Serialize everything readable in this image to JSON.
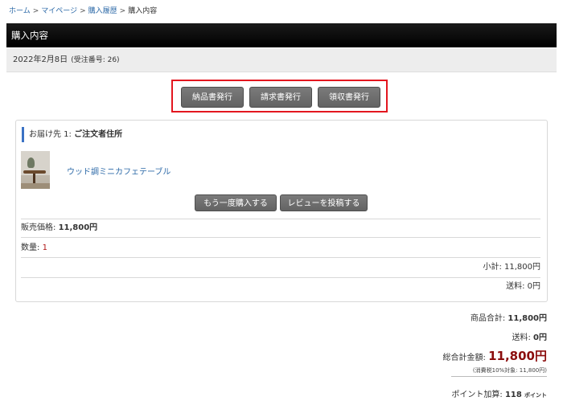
{
  "breadcrumb": {
    "home": "ホーム",
    "mypage": "マイページ",
    "history": "購入履歴",
    "current": "購入内容",
    "separator": ">"
  },
  "page_title": "購入内容",
  "order": {
    "date": "2022年2月8日",
    "order_no": "(受注番号: 26)"
  },
  "doc_buttons": {
    "delivery_note": "納品書発行",
    "invoice": "請求書発行",
    "receipt": "領収書発行"
  },
  "shipping": {
    "prefix": "お届け先 1:",
    "name": "ご注文者住所"
  },
  "product": {
    "name": "ウッド調ミニカフェテーブル",
    "buy_again": "もう一度購入する",
    "post_review": "レビューを投稿する"
  },
  "item": {
    "price_label": "販売価格:",
    "price_value": "11,800円",
    "qty_label": "数量:",
    "qty_value": "1",
    "subtotal": "小計: 11,800円",
    "shipping_fee": "送料: 0円"
  },
  "summary": {
    "goods_total_label": "商品合計:",
    "goods_total_value": "11,800円",
    "shipping_label": "送料:",
    "shipping_value": "0円",
    "grand_total_label": "総合計金額:",
    "grand_total_value": "11,800円",
    "tax_note": "(消費税10%対象: 11,800円)",
    "points_label": "ポイント加算:",
    "points_value": "118",
    "points_unit": "ポイント"
  },
  "colors": {
    "link": "#2d6aa8",
    "highlight_border": "#e3161f",
    "price_red": "#b01717",
    "grand_total": "#8b0d0d",
    "accent_bar": "#3b72c4"
  }
}
